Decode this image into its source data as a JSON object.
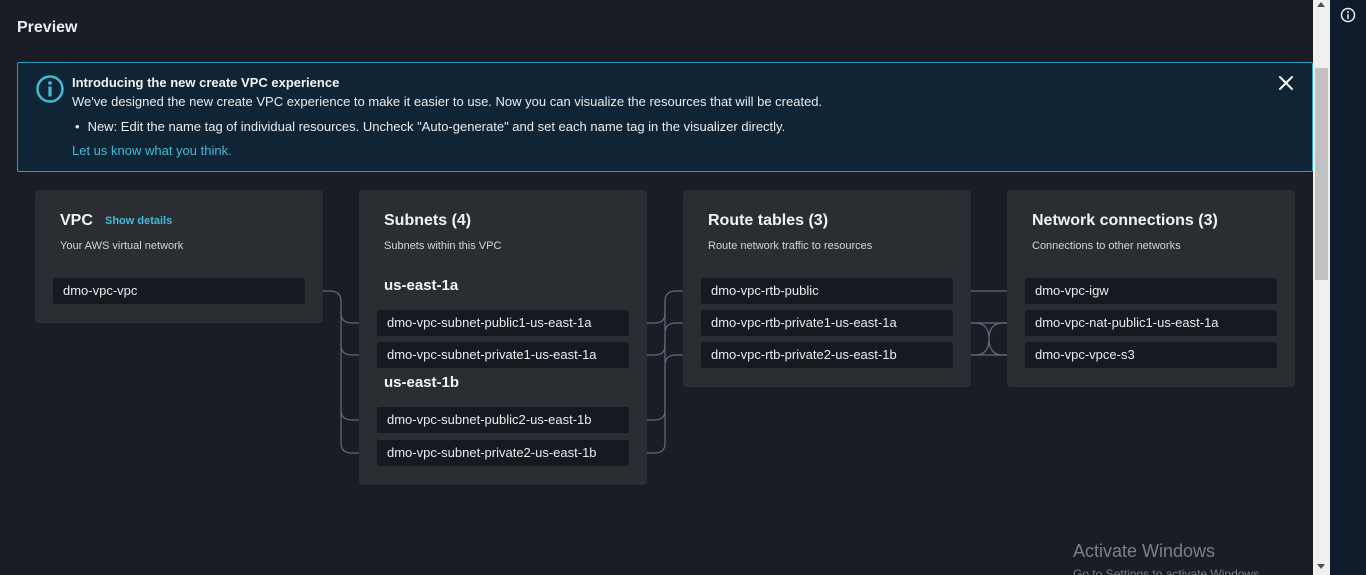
{
  "page": {
    "title": "Preview"
  },
  "flash": {
    "title": "Introducing the new create VPC experience",
    "body": "We've designed the new create VPC experience to make it easier to use. Now you can visualize the resources that will be created.",
    "bullet": "New: Edit the name tag of individual resources. Uncheck \"Auto-generate\" and set each name tag in the visualizer directly.",
    "link": "Let us know what you think.",
    "accent": "#2aa1c2"
  },
  "vpc": {
    "title": "VPC",
    "show_details": "Show details",
    "subtitle": "Your AWS virtual network",
    "items": [
      "dmo-vpc-vpc"
    ]
  },
  "subnets": {
    "title": "Subnets (4)",
    "subtitle": "Subnets within this VPC",
    "az1": "us-east-1a",
    "az2": "us-east-1b",
    "items": [
      "dmo-vpc-subnet-public1-us-east-1a",
      "dmo-vpc-subnet-private1-us-east-1a",
      "dmo-vpc-subnet-public2-us-east-1b",
      "dmo-vpc-subnet-private2-us-east-1b"
    ]
  },
  "route_tables": {
    "title": "Route tables (3)",
    "subtitle": "Route network traffic to resources",
    "items": [
      "dmo-vpc-rtb-public",
      "dmo-vpc-rtb-private1-us-east-1a",
      "dmo-vpc-rtb-private2-us-east-1b"
    ]
  },
  "network": {
    "title": "Network connections (3)",
    "subtitle": "Connections to other networks",
    "items": [
      "dmo-vpc-igw",
      "dmo-vpc-nat-public1-us-east-1a",
      "dmo-vpc-vpce-s3"
    ]
  },
  "watermark": {
    "line1": "Activate Windows",
    "line2": "Go to Settings to activate Windows."
  },
  "colors": {
    "background": "#1a1d25",
    "panel": "#2a2e33",
    "link": "#44b9d6",
    "connector": "#5f6b7a"
  }
}
